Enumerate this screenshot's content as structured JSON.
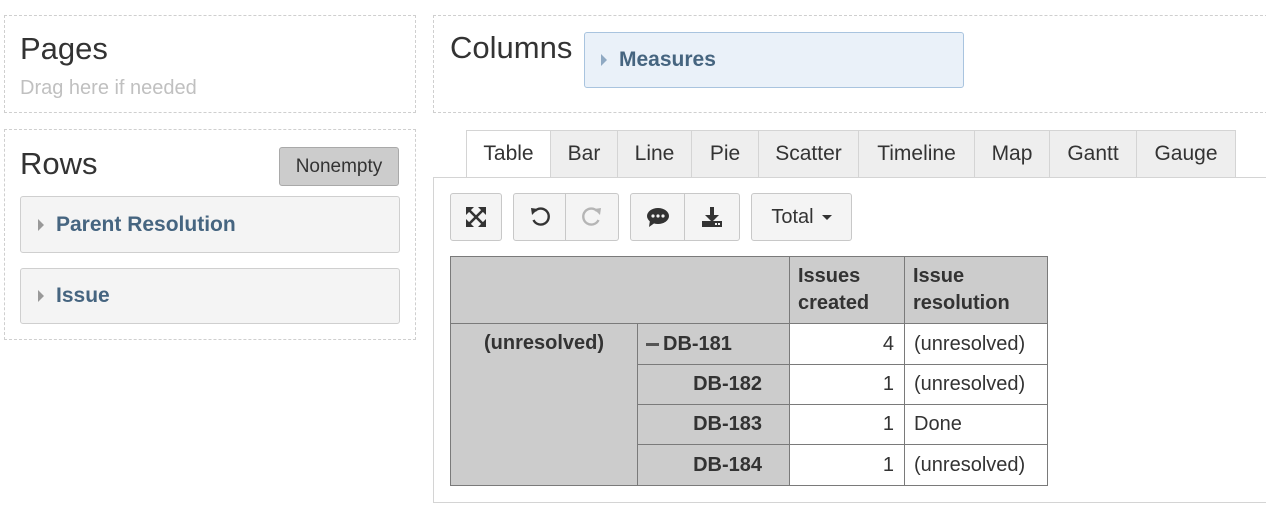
{
  "pages": {
    "title": "Pages",
    "hint": "Drag here if needed"
  },
  "rows": {
    "title": "Rows",
    "nonempty_label": "Nonempty",
    "dimensions": [
      "Parent Resolution",
      "Issue"
    ]
  },
  "columns": {
    "title": "Columns",
    "dimensions": [
      "Measures"
    ]
  },
  "tabs": [
    "Table",
    "Bar",
    "Line",
    "Pie",
    "Scatter",
    "Timeline",
    "Map",
    "Gantt",
    "Gauge"
  ],
  "active_tab": "Table",
  "toolbar": {
    "icons": [
      "fullscreen-icon",
      "undo-icon",
      "redo-icon",
      "comment-icon",
      "download-icon"
    ],
    "total_label": "Total"
  },
  "table": {
    "headers": [
      "Issues created",
      "Issue resolution"
    ],
    "group": "(unresolved)",
    "rows": [
      {
        "issue": "DB-181",
        "created": "4",
        "resolution": "(unresolved)"
      },
      {
        "issue": "DB-182",
        "created": "1",
        "resolution": "(unresolved)"
      },
      {
        "issue": "DB-183",
        "created": "1",
        "resolution": "Done"
      },
      {
        "issue": "DB-184",
        "created": "1",
        "resolution": "(unresolved)"
      }
    ]
  },
  "colors": {
    "accent": "#466580",
    "header_bg": "#cccccc",
    "measures_bg": "#eaf1f9"
  }
}
